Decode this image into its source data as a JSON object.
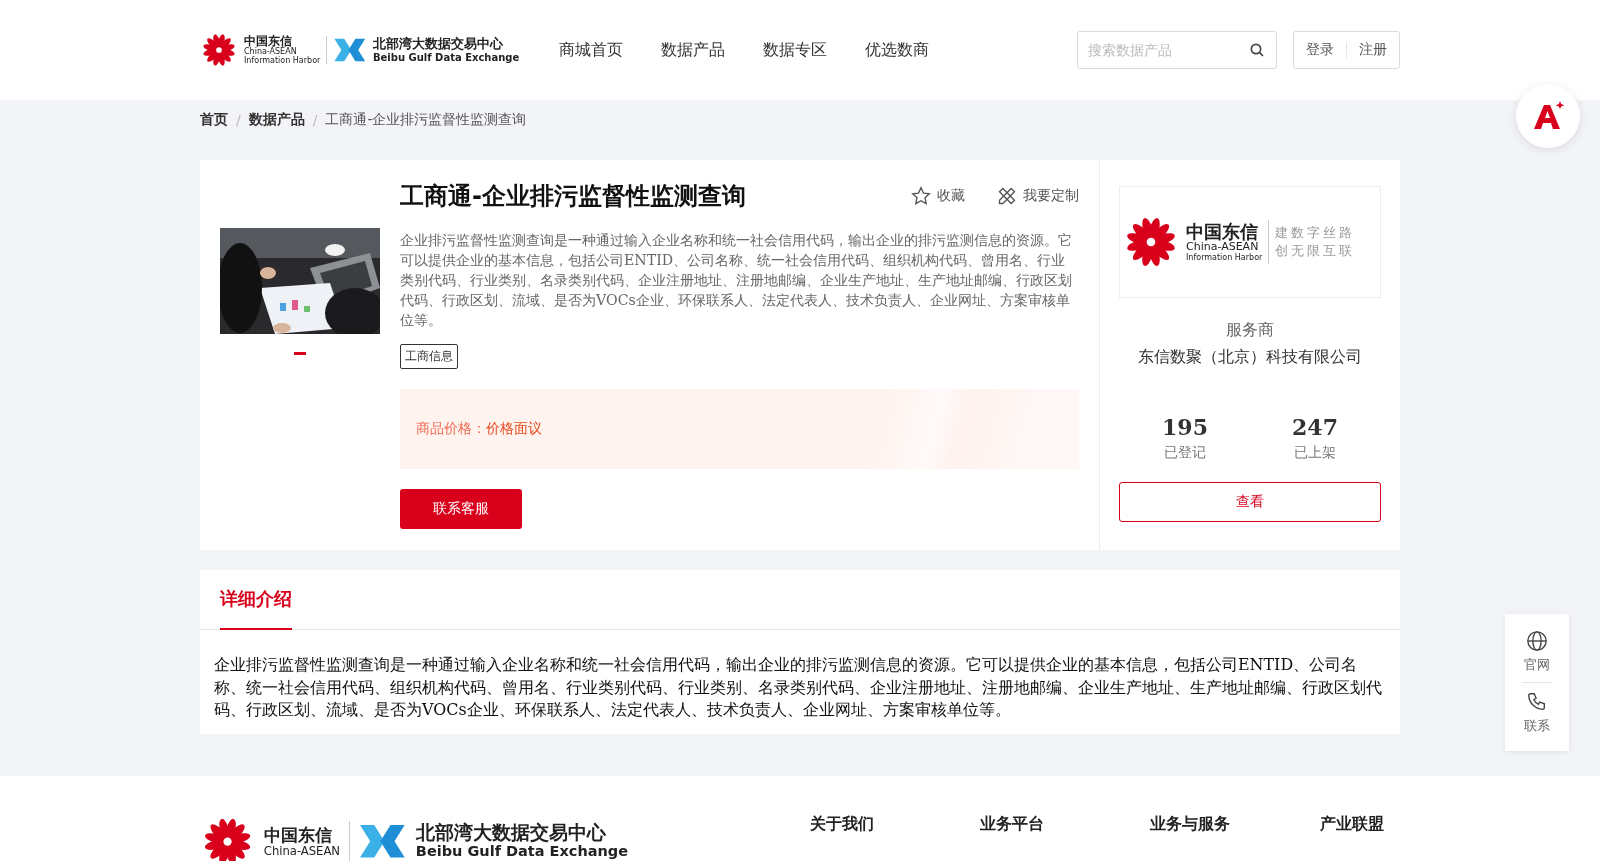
{
  "header": {
    "logo": {
      "cn": "中国东信",
      "en1": "China-ASEAN",
      "en2": "Information Harbor",
      "cn2": "北部湾大数据交易中心",
      "en3": "Beibu Gulf Data Exchange"
    },
    "nav": [
      {
        "label": "商城首页",
        "selected": false
      },
      {
        "label": "数据产品",
        "selected": false
      },
      {
        "label": "数据专区",
        "selected": false
      },
      {
        "label": "优选数商",
        "selected": false
      }
    ],
    "search": {
      "placeholder": "搜索数据产品"
    },
    "auth": [
      "登录",
      "注册"
    ]
  },
  "breadcrumb": {
    "separator": "/",
    "items": [
      "首页",
      "数据产品",
      "工商通-企业排污监督性监测查询"
    ]
  },
  "product": {
    "title": "工商通-企业排污监督性监测查询",
    "actions": [
      {
        "kind": "star",
        "label": "收藏"
      },
      {
        "kind": "custom",
        "label": "我要定制"
      }
    ],
    "description": "企业排污监督性监测查询是一种通过输入企业名称和统一社会信用代码，输出企业的排污监测信息的资源。它可以提供企业的基本信息，包括公司ENTID、公司名称、统一社会信用代码、组织机构代码、曾用名、行业类别代码、行业类别、名录类别代码、企业注册地址、注册地邮编、企业生产地址、生产地址邮编、行政区划代码、行政区划、流域、是否为VOCs企业、环保联系人、法定代表人、技术负责人、企业网址、方案审核单位等。",
    "tags": [
      "工商信息"
    ],
    "price_label": "商品价格：",
    "price": "价格面议",
    "contact_button": "联系客服",
    "slides": [
      {
        "selected": true
      }
    ]
  },
  "provider": {
    "logo": {
      "cn": "中国东信",
      "en1": "China-ASEAN",
      "en2": "Information Harbor",
      "slogan1": "建数字丝路",
      "slogan2": "创无限互联"
    },
    "label": "服务商",
    "name": "东信数聚（北京）科技有限公司",
    "stats": [
      {
        "value": "195",
        "label": "已登记"
      },
      {
        "value": "247",
        "label": "已上架"
      }
    ],
    "view_button": "查看"
  },
  "detail": {
    "tabs": [
      {
        "label": "详细介绍",
        "selected": true
      }
    ],
    "text": "企业排污监督性监测查询是一种通过输入企业名称和统一社会信用代码，输出企业的排污监测信息的资源。它可以提供企业的基本信息，包括公司ENTID、公司名称、统一社会信用代码、组织机构代码、曾用名、行业类别代码、行业类别、名录类别代码、企业注册地址、注册地邮编、企业生产地址、生产地址邮编、行政区划代码、行政区划、流域、是否为VOCs企业、环保联系人、法定代表人、技术负责人、企业网址、方案审核单位等。"
  },
  "side_tools": [
    {
      "kind": "globe",
      "label": "官网"
    },
    {
      "kind": "phone",
      "label": "联系"
    }
  ],
  "footer": {
    "logo": {
      "cn": "中国东信",
      "en1": "China-ASEAN",
      "cn2": "北部湾大数据交易中心",
      "en3": "Beibu Gulf Data Exchange"
    },
    "links": [
      "关于我们",
      "业务平台",
      "业务与服务",
      "产业联盟"
    ]
  }
}
